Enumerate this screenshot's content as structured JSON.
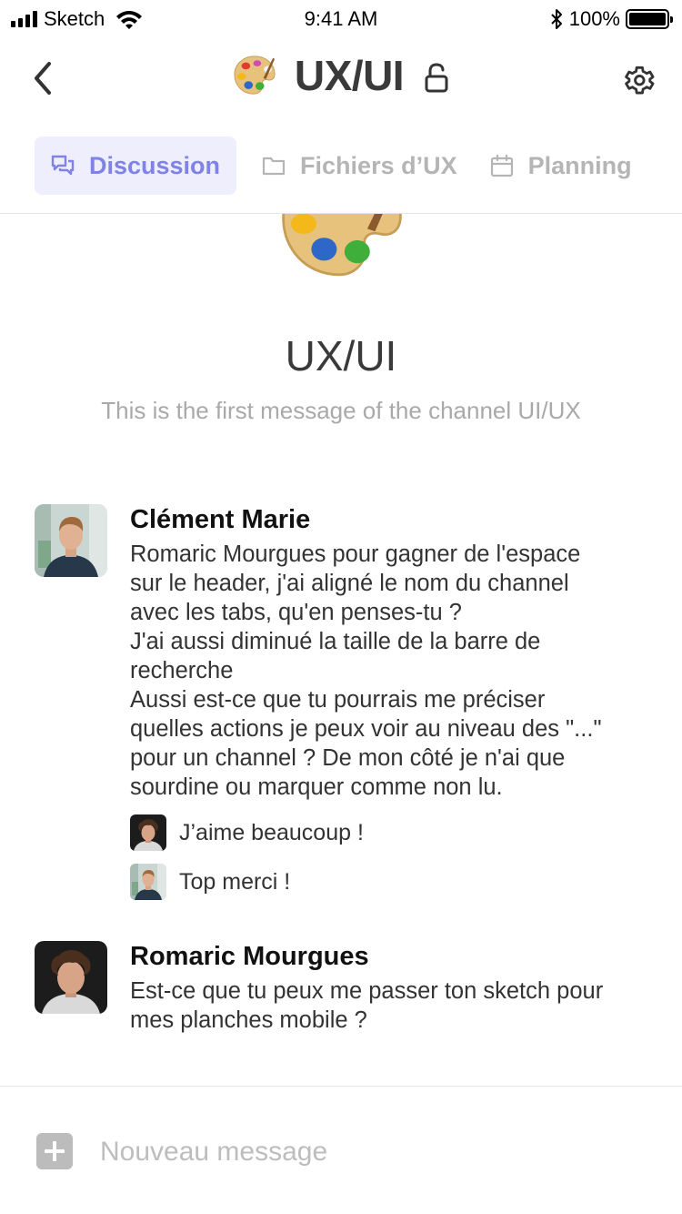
{
  "status_bar": {
    "carrier": "Sketch",
    "time": "9:41 AM",
    "battery": "100%",
    "battery_level": 1.0,
    "icons": [
      "signal-icon",
      "wifi-icon",
      "bluetooth-icon",
      "battery-icon"
    ]
  },
  "header": {
    "title": "UX/UI",
    "icons": [
      "back-chevron-icon",
      "palette-icon",
      "lock-open-icon",
      "gear-icon"
    ]
  },
  "tabs": [
    {
      "label": "Discussion",
      "icon": "chat-icon",
      "active": true
    },
    {
      "label": "Fichiers d’UX",
      "icon": "folder-icon",
      "active": false
    },
    {
      "label": "Planning",
      "icon": "calendar-icon",
      "active": false
    }
  ],
  "channel_intro": {
    "title": "UX/UI",
    "subtitle": "This is the first message of the channel UI/UX"
  },
  "messages": [
    {
      "author": "Clément Marie",
      "lines": [
        "Romaric Mourgues pour gagner de l'espace",
        "sur le header, j'ai aligné le nom du channel",
        "avec les tabs, qu'en penses-tu ?",
        "J'ai aussi diminué la taille de la barre de",
        "recherche",
        "Aussi est-ce que tu pourrais me préciser",
        "quelles actions je peux voir au niveau des \"...\"",
        "pour un channel ? De mon côté je n'ai que",
        "sourdine ou marquer comme non lu."
      ],
      "replies": [
        {
          "text": "J’aime beaucoup !"
        },
        {
          "text": "Top merci !"
        }
      ]
    },
    {
      "author": "Romaric Mourgues",
      "lines": [
        "Est-ce que tu peux me passer ton sketch pour",
        "mes planches mobile ?"
      ]
    }
  ],
  "composer": {
    "placeholder": "Nouveau message",
    "icon": "plus-icon"
  },
  "colors": {
    "accent": "#7f82e6",
    "accent_bg": "#eeeefc",
    "inactive_tab": "#b5b5b5",
    "muted_text": "#a9a9a9"
  }
}
